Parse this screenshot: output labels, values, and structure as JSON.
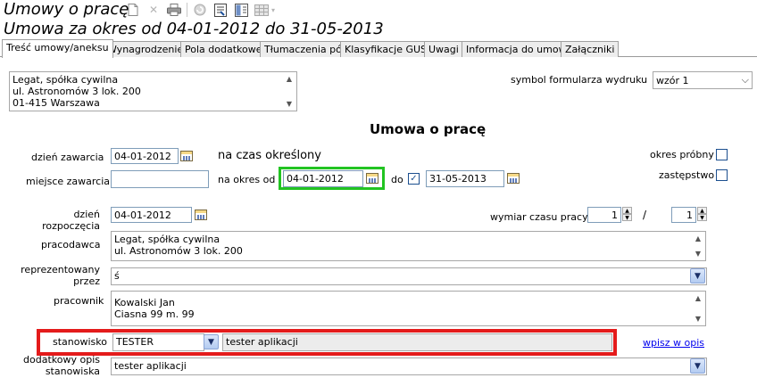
{
  "window": {
    "title": "Umowy o pracę",
    "subtitle": "Umowa za okres od 04-01-2012 do 31-05-2013"
  },
  "tabs": [
    {
      "label": "Treść umowy/aneksu",
      "active": true
    },
    {
      "label": "Wynagrodzenie",
      "active": false
    },
    {
      "label": "Pola dodatkowe",
      "active": false
    },
    {
      "label": "Tłumaczenia pól",
      "active": false
    },
    {
      "label": "Klasyfikacje GUS",
      "active": false
    },
    {
      "label": "Uwagi",
      "active": false
    },
    {
      "label": "Informacja do umowy",
      "active": false
    },
    {
      "label": "Załączniki",
      "active": false
    }
  ],
  "header_address": {
    "line1": "Legat, spółka cywilna",
    "line2": "ul. Astronomów 3 lok. 200",
    "line3": "01-415 Warszawa"
  },
  "print_form": {
    "label": "symbol formularza wydruku",
    "value": "wzór 1"
  },
  "form": {
    "heading": "Umowa o pracę",
    "date_concluded_label": "dzień zawarcia",
    "date_concluded": "04-01-2012",
    "contract_type": "na czas określony",
    "place_label": "miejsce zawarcia",
    "place_value": "",
    "period_from_label": "na okres od",
    "period_from": "04-01-2012",
    "period_to_label": "do",
    "period_to": "31-05-2013",
    "trial_label": "okres próbny",
    "substitute_label": "zastępstwo",
    "start_label_1": "dzień",
    "start_label_2": "rozpoczęcia",
    "start_date": "04-01-2012",
    "worktime_label": "wymiar czasu pracy",
    "worktime_num": "1",
    "worktime_sep": "/",
    "worktime_den": "1",
    "employer_label": "pracodawca",
    "employer_line1": "Legat, spółka cywilna",
    "employer_line2": "ul. Astronomów 3 lok. 200",
    "representative_label_1": "reprezentowany",
    "representative_label_2": "przez",
    "representative_value": "ś",
    "employee_label": "pracownik",
    "employee_line1": "Kowalski Jan",
    "employee_line2": "Ciasna 99 m. 99",
    "position_label": "stanowisko",
    "position_code": "TESTER",
    "position_desc": "tester aplikacji",
    "insert_link": "wpisz w opis",
    "extra_desc_label_1": "dodatkowy opis",
    "extra_desc_label_2": "stanowiska",
    "extra_desc_value": "tester aplikacji"
  },
  "colors": {
    "highlight_green": "#22c422",
    "highlight_red": "#e41b1b",
    "link": "#0000ee"
  }
}
